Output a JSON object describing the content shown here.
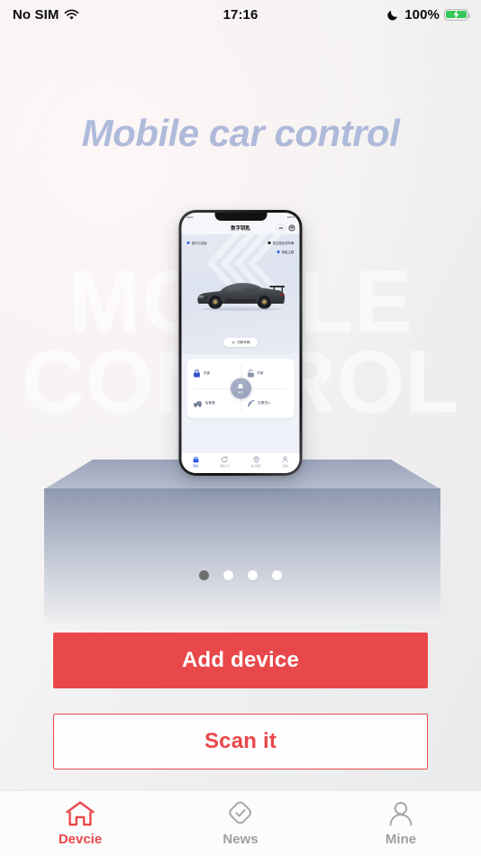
{
  "status_bar": {
    "carrier": "No SIM",
    "wifi_icon": "wifi-icon",
    "time": "17:16",
    "moon_icon": "moon-icon",
    "battery_percent": "100%",
    "battery_icon": "battery-charging-icon",
    "battery_color": "#34c759"
  },
  "hero": {
    "headline": "Mobile car control",
    "headline_color": "#a9b6d8",
    "watermark": "MOBILE\nCONTROL"
  },
  "phone_preview": {
    "status": {
      "left": "Apple",
      "right": "100 %"
    },
    "appbar": {
      "title": "数字钥匙",
      "icon_pill": "card-icon",
      "icon_settings": "gear-icon"
    },
    "badges": [
      {
        "id": "bluetooth",
        "label": "蓝牙已连接",
        "icon": "bluetooth-dot-icon"
      },
      {
        "id": "nearby",
        "label": "靠近感应成车辆",
        "icon": "sensor-icon"
      },
      {
        "id": "key",
        "label": "钥匙主题",
        "icon": "key-shield-icon"
      }
    ],
    "switch_button": {
      "label": "切换车辆",
      "icon": "swap-icon"
    },
    "controls": [
      {
        "id": "lock",
        "label": "关锁",
        "icon": "lock-closed-icon"
      },
      {
        "id": "unlock",
        "label": "开锁",
        "icon": "lock-open-icon"
      },
      {
        "id": "trunk",
        "label": "后备箱",
        "icon": "trunk-icon"
      },
      {
        "id": "keyless",
        "label": "无感进入",
        "icon": "signal-icon"
      }
    ],
    "center_button": {
      "label": "寻车",
      "icon": "bell-icon"
    },
    "tabs": [
      {
        "id": "key",
        "label": "钥匙",
        "icon": "car-key-icon",
        "active": true
      },
      {
        "id": "share",
        "label": "钥匙分享",
        "icon": "share-icon",
        "active": false
      },
      {
        "id": "fence",
        "label": "电子围栏",
        "icon": "location-icon",
        "active": false
      },
      {
        "id": "mine",
        "label": "我的",
        "icon": "person-icon",
        "active": false
      }
    ]
  },
  "carousel": {
    "total": 4,
    "active_index": 0,
    "active_color": "#6e6e6e",
    "inactive_color": "#ffffff"
  },
  "actions": {
    "primary_label": "Add device",
    "primary_color": "#e9484a",
    "secondary_label": "Scan it",
    "secondary_color": "#e9484a"
  },
  "tabbar": {
    "active_color": "#e9484a",
    "inactive_color": "#a0a0a0",
    "items": [
      {
        "id": "device",
        "label": "Devcie",
        "icon": "home-icon",
        "active": true
      },
      {
        "id": "news",
        "label": "News",
        "icon": "diamond-check-icon",
        "active": false
      },
      {
        "id": "mine",
        "label": "Mine",
        "icon": "person-icon",
        "active": false
      }
    ]
  }
}
